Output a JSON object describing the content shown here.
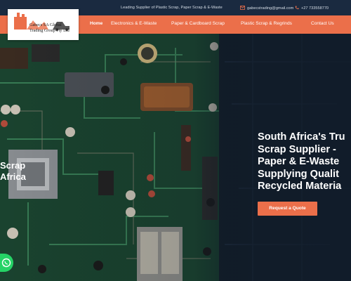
{
  "topbar": {
    "tagline": "Leading Supplier of Plastic Scrap, Paper Scrap & E-Waste",
    "email": "gabecstrading@gmail.com",
    "phone": "+27 733558770"
  },
  "logo": {
    "line1": "Gabecs SA Global",
    "line2": "Trading Group Pty Ltd"
  },
  "nav": [
    {
      "label": "Home"
    },
    {
      "label": "Electronics & E-Waste"
    },
    {
      "label": "Paper & Cardboard Scrap"
    },
    {
      "label": "Plastic Scrap & Regrinds"
    },
    {
      "label": "Contact Us"
    }
  ],
  "hero": {
    "side_lines": [
      "Scrap",
      "Africa"
    ],
    "headline_lines": [
      "South Africa's Tru",
      "Scrap Supplier -",
      "Paper & E-Waste",
      "Supplying Qualit",
      "Recycled Materia"
    ],
    "cta_label": "Request a Quote"
  },
  "colors": {
    "accent": "#eb6f4a",
    "topbar": "#1a2a40",
    "whatsapp": "#25d366"
  },
  "icons": [
    "email-icon",
    "phone-icon",
    "whatsapp-icon"
  ]
}
